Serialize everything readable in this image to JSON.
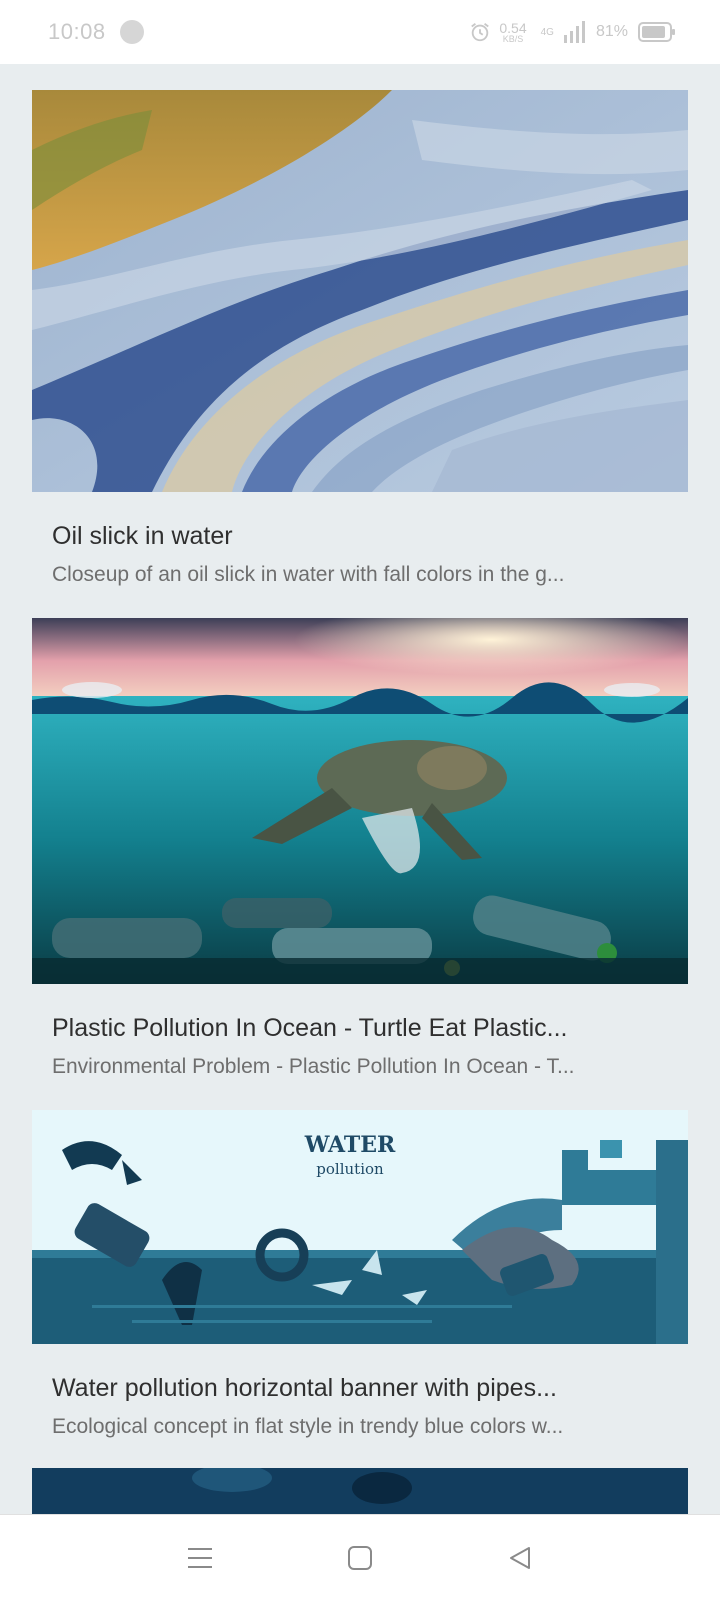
{
  "status_bar": {
    "time": "10:08",
    "net_speed_value": "0.54",
    "net_speed_unit": "KB/S",
    "network_type": "4G",
    "battery_percent": "81%",
    "icons": [
      "alarm-icon",
      "signal-icon",
      "battery-icon"
    ]
  },
  "feed": {
    "items": [
      {
        "title": "Oil slick in water",
        "description": "Closeup of an oil slick in water with fall colors in the g..."
      },
      {
        "title": "Plastic Pollution In Ocean - Turtle Eat Plastic...",
        "description": "Environmental Problem - Plastic Pollution In Ocean - T..."
      },
      {
        "title": "Water pollution horizontal banner with pipes...",
        "description": "Ecological concept in flat style in trendy blue colors w...",
        "image_text": {
          "heading": "WATER",
          "subheading": "pollution"
        }
      }
    ]
  },
  "nav_bar": {
    "icons": [
      "menu-icon",
      "home-square-icon",
      "back-triangle-icon"
    ]
  },
  "colors": {
    "background": "#e8edef",
    "status_text": "#c8c8c8",
    "title_text": "#2f2f2f",
    "description_text": "#6e6e6e"
  }
}
